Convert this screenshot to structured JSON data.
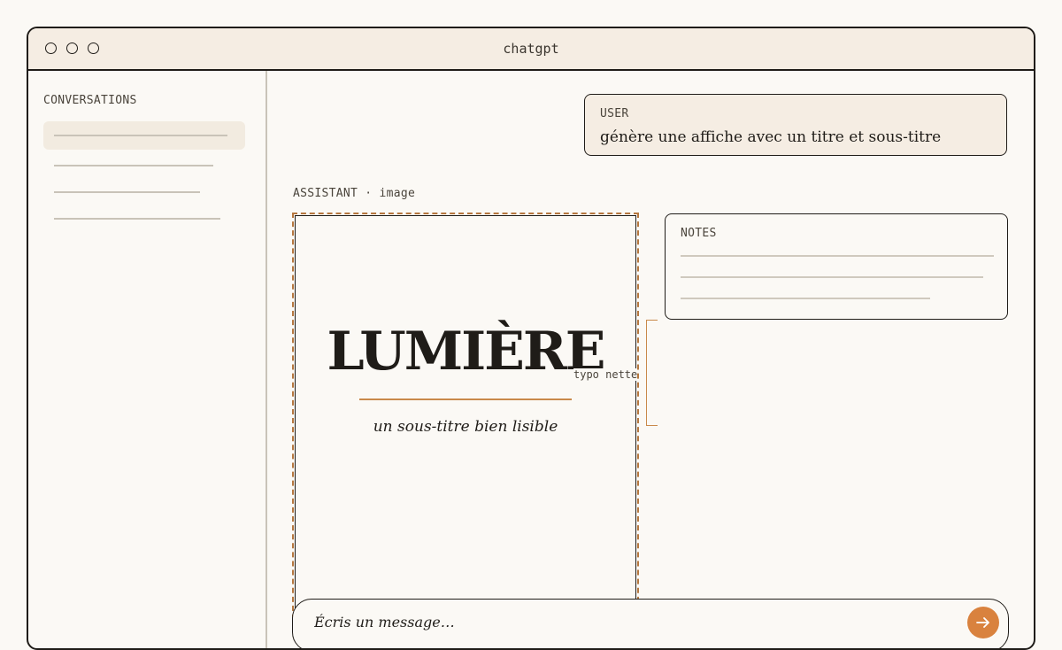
{
  "window": {
    "title": "chatgpt"
  },
  "sidebar": {
    "heading": "CONVERSATIONS",
    "items": [
      {
        "active": true
      },
      {
        "active": false
      },
      {
        "active": false
      },
      {
        "active": false
      }
    ]
  },
  "user_message": {
    "role": "USER",
    "text": "génère une affiche avec un titre et sous-titre"
  },
  "assistant": {
    "label": "ASSISTANT · image"
  },
  "poster": {
    "title": "LUMIÈRE",
    "subtitle": "un sous-titre bien lisible",
    "annotation": "typo nette"
  },
  "notes": {
    "heading": "NOTES"
  },
  "composer": {
    "placeholder": "Écris un message…",
    "send_icon": "arrow-right-icon"
  },
  "colors": {
    "accent": "#d9823e",
    "ink": "#1f1c18",
    "panel": "#f5ede3",
    "background": "#fbf9f5"
  }
}
